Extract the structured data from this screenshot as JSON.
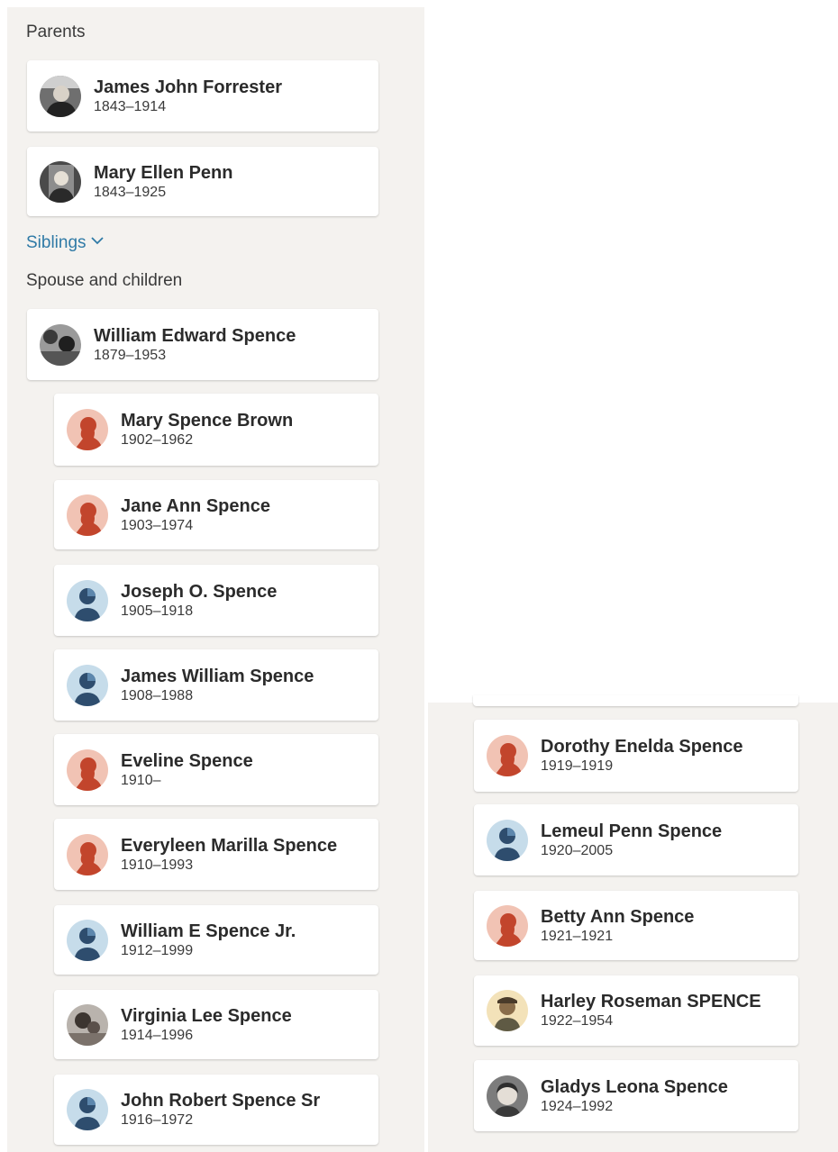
{
  "parents_label": "Parents",
  "siblings_label": "Siblings",
  "spouse_children_label": "Spouse and children",
  "colors": {
    "panel_bg": "#f4f2ef",
    "link_blue": "#2f7aa6",
    "female_icon_bg": "#f1c3b4",
    "female_icon_fg": "#c2452c",
    "male_icon_bg": "#c6dcea",
    "male_icon_fg": "#2e4d6e"
  },
  "parents": [
    {
      "name": "James John Forrester",
      "dates": "1843–1914",
      "avatar": "photo-icon"
    },
    {
      "name": "Mary Ellen Penn",
      "dates": "1843–1925",
      "avatar": "photo-icon"
    }
  ],
  "spouse": {
    "name": "William Edward Spence",
    "dates": "1879–1953",
    "avatar": "photo-icon"
  },
  "children": [
    {
      "name": "Mary Spence Brown",
      "dates": "1902–1962",
      "avatar": "female-silhouette-icon"
    },
    {
      "name": "Jane Ann Spence",
      "dates": "1903–1974",
      "avatar": "female-silhouette-icon"
    },
    {
      "name": "Joseph O. Spence",
      "dates": "1905–1918",
      "avatar": "male-silhouette-icon"
    },
    {
      "name": "James William Spence",
      "dates": "1908–1988",
      "avatar": "male-silhouette-icon"
    },
    {
      "name": "Eveline Spence",
      "dates": "1910–",
      "avatar": "female-silhouette-icon"
    },
    {
      "name": "Everyleen Marilla Spence",
      "dates": "1910–1993",
      "avatar": "female-silhouette-icon"
    },
    {
      "name": "William E Spence Jr.",
      "dates": "1912–1999",
      "avatar": "male-silhouette-icon"
    },
    {
      "name": "Virginia Lee Spence",
      "dates": "1914–1996",
      "avatar": "photo-icon"
    },
    {
      "name": "John Robert Spence Sr",
      "dates": "1916–1972",
      "avatar": "male-silhouette-icon"
    },
    {
      "name": "Dorothy Enelda Spence",
      "dates": "1919–1919",
      "avatar": "female-silhouette-icon"
    },
    {
      "name": "Lemeul Penn Spence",
      "dates": "1920–2005",
      "avatar": "male-silhouette-icon"
    },
    {
      "name": "Betty Ann Spence",
      "dates": "1921–1921",
      "avatar": "female-silhouette-icon"
    },
    {
      "name": "Harley Roseman SPENCE",
      "dates": "1922–1954",
      "avatar": "photo-icon"
    },
    {
      "name": "Gladys Leona Spence",
      "dates": "1924–1992",
      "avatar": "photo-icon"
    }
  ]
}
